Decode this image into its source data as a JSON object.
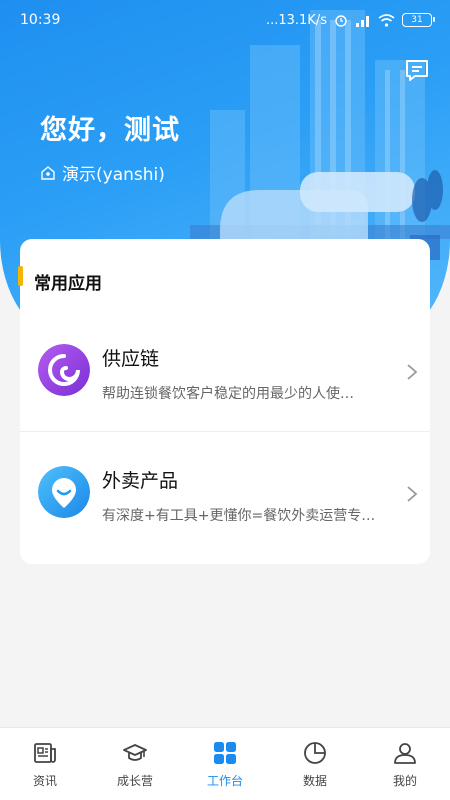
{
  "status_bar": {
    "time": "10:39",
    "net_speed": "...13.1K/s",
    "battery": "31"
  },
  "header": {
    "greeting": "您好，测试",
    "tenant": "演示(yanshi)"
  },
  "card": {
    "title": "常用应用",
    "apps": [
      {
        "name": "供应链",
        "desc": "帮助连锁餐饮客户稳定的用最少的人使…",
        "icon": "swirl-icon",
        "color": "#8e3fe0"
      },
      {
        "name": "外卖产品",
        "desc": "有深度+有工具+更懂你=餐饮外卖运营专…",
        "icon": "smile-pin-icon",
        "color": "#1f9cf0"
      }
    ]
  },
  "nav": {
    "items": [
      {
        "label": "资讯",
        "icon": "newspaper-icon"
      },
      {
        "label": "成长营",
        "icon": "graduation-cap-icon"
      },
      {
        "label": "工作台",
        "icon": "grid-icon",
        "active": true
      },
      {
        "label": "数据",
        "icon": "pie-chart-icon"
      },
      {
        "label": "我的",
        "icon": "user-icon"
      }
    ],
    "active_color": "#1a8cf0"
  }
}
